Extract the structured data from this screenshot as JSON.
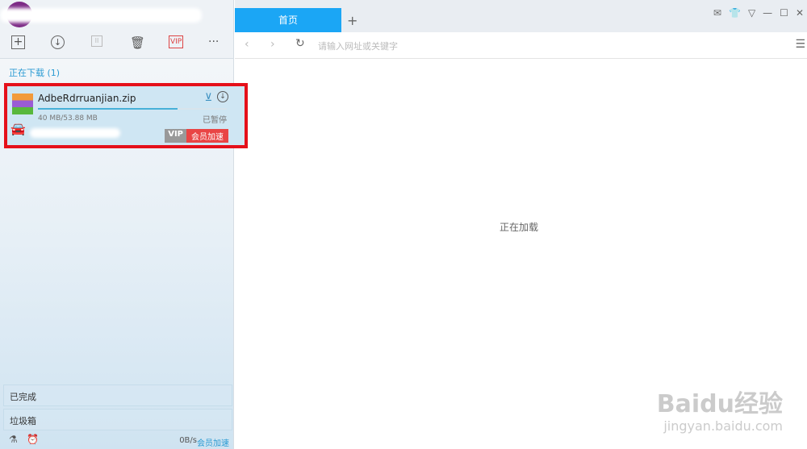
{
  "toolbar": {
    "new": "+",
    "download": "↓",
    "pause": "II",
    "delete": "🗑",
    "vip": "VIP",
    "more": "···"
  },
  "section_downloading": "正在下载 (1)",
  "download_item": {
    "filename": "AdbeRdrruanjian.zip",
    "size": "40 MB/53.88 MB",
    "status": "已暂停",
    "progress_percent": 74,
    "vip_label": "VIP",
    "accelerate": "会员加速"
  },
  "sidebar_bottom": {
    "completed": "已完成",
    "trash": "垃圾箱",
    "speed": "0B/s",
    "accelerate": "会员加速"
  },
  "browser": {
    "tab": "首页",
    "new_tab": "+",
    "address_placeholder": "请输入网址或关键字",
    "loading": "正在加载"
  },
  "watermark": {
    "brand": "Baidu经验",
    "url": "jingyan.baidu.com"
  }
}
